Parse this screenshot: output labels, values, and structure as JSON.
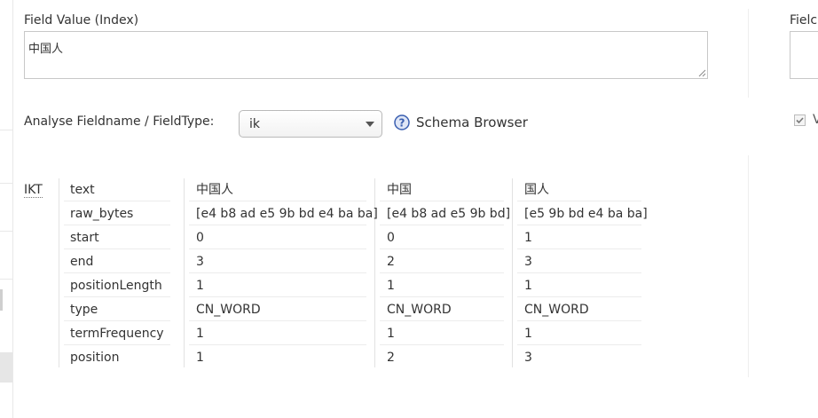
{
  "field_value": {
    "label": "Field Value (Index)",
    "value": "中国人"
  },
  "right_panel": {
    "label": "Fielc",
    "checkbox_letter": "V"
  },
  "analyse": {
    "label": "Analyse Fieldname / FieldType:",
    "selected": "ik",
    "schema_browser": "Schema Browser"
  },
  "analysis": {
    "tokenizer": "IKT",
    "attributes": [
      "text",
      "raw_bytes",
      "start",
      "end",
      "positionLength",
      "type",
      "termFrequency",
      "position"
    ],
    "tokens": [
      [
        "中国人",
        "[e4 b8 ad e5 9b bd e4 ba ba]",
        "0",
        "3",
        "1",
        "CN_WORD",
        "1",
        "1"
      ],
      [
        "中国",
        "[e4 b8 ad e5 9b bd]",
        "0",
        "2",
        "1",
        "CN_WORD",
        "1",
        "2"
      ],
      [
        "国人",
        "[e5 9b bd e4 ba ba]",
        "1",
        "3",
        "1",
        "CN_WORD",
        "1",
        "3"
      ]
    ]
  },
  "colors": {
    "help_icon": "#3a5fb0",
    "border": "#c8c8c8"
  }
}
